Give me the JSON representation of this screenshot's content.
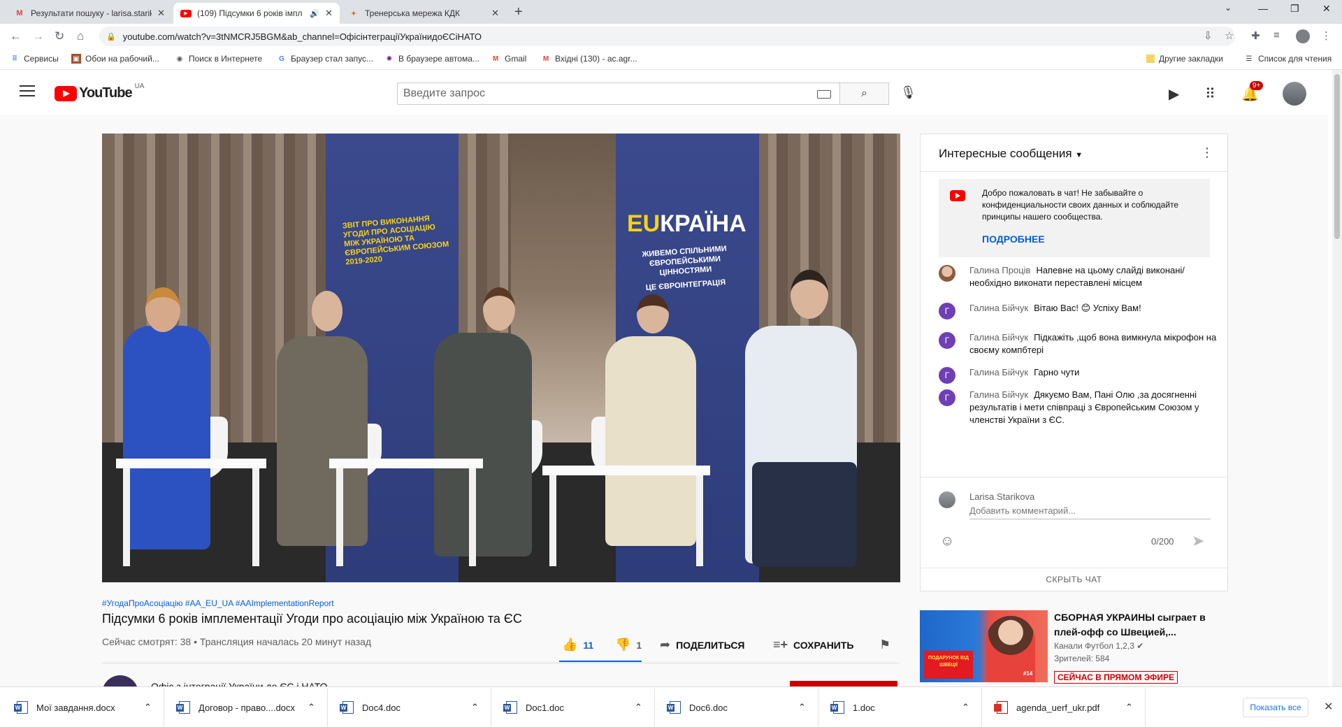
{
  "browser": {
    "tabs": [
      {
        "title": "Результати пошуку - larisa.stariko",
        "favicon": "gmail-icon"
      },
      {
        "title": "(109) Підсумки 6 років імпл",
        "favicon": "youtube-icon",
        "active": true
      },
      {
        "title": "Тренерська мережа КДК",
        "favicon": "site-icon"
      }
    ],
    "url": "youtube.com/watch?v=3tNMCRJ5BGM&ab_channel=ОфісінтеграціїУкраїнидоЄСіНАТО",
    "bookmarks": [
      {
        "label": "Сервисы",
        "icon": "apps-icon"
      },
      {
        "label": "Обои на рабочий...",
        "icon": "wallpaper-icon"
      },
      {
        "label": "Поиск в Интернете",
        "icon": "search-web-icon"
      },
      {
        "label": "Браузер стал запус...",
        "icon": "google-icon"
      },
      {
        "label": "В браузере автома...",
        "icon": "virus-icon"
      },
      {
        "label": "Gmail",
        "icon": "gmail-icon"
      },
      {
        "label": "Вхідні (130) - ac.agr...",
        "icon": "gmail-icon"
      }
    ],
    "other_bookmarks": "Другие закладки",
    "reading_list": "Список для чтения"
  },
  "youtube": {
    "country_code": "UA",
    "search_placeholder": "Введите запрос",
    "notification_count": "9+",
    "video": {
      "banner_left_text": "ЗВІТ ПРО ВИКОНАННЯ УГОДИ ПРО АСОЦІАЦІЮ МІЖ УКРАЇНОЮ ТА ЄВРОПЕЙСЬКИМ СОЮЗОМ 2019-2020",
      "banner_right_logo_eu": "EU",
      "banner_right_logo_rest": "КРАЇНА",
      "banner_right_slogan": "ЖИВЕМО СПІЛЬНИМИ ЄВРОПЕЙСЬКИМИ ЦІННОСТЯМИ",
      "banner_right_tag": "ЦЕ ЄВРОІНТЕГРАЦІЯ",
      "hashtags": "#УгодаПроАсоціацію #AA_EU_UA #AAImplementationReport",
      "title": "Підсумки 6 років імплементації Угоди про асоціацію між Україною та ЄС",
      "stats": "Сейчас смотрят: 38 • Трансляция началась 20 минут назад",
      "likes": "11",
      "dislikes": "1",
      "share_label": "ПОДЕЛИТЬСЯ",
      "save_label": "СОХРАНИТЬ",
      "channel_name": "Офіс з інтеграції України до ЄС і НАТО"
    },
    "chat": {
      "header": "Интересные сообщения",
      "welcome_text": "Добро пожаловать в чат! Не забывайте о конфиденциальности своих данных и соблюдайте принципы нашего сообщества.",
      "welcome_link": "ПОДРОБНЕЕ",
      "messages": [
        {
          "author": "Галина Проців",
          "text": "Напевне на цьому слайді виконані/ необхідно виконати переставлені місцем",
          "avatar": "photo"
        },
        {
          "author": "Галина Бійчук",
          "text": "Вітаю Вас! 😊 Успіху Вам!",
          "avatar": "Г"
        },
        {
          "author": "Галина Бійчук",
          "text": "Підкажіть ,щоб вона вимкнула мікрофон на своєму компбтері",
          "avatar": "Г"
        },
        {
          "author": "Галина Бійчук",
          "text": "Гарно чути",
          "avatar": "Г"
        },
        {
          "author": "Галина Бійчук",
          "text": "Дякуємо Вам, Пані Олю ,за досягненні результатів і мети співпраці з Європейським Союзом у членстві України з ЄС.",
          "avatar": "Г"
        }
      ],
      "current_user": "Larisa Starikova",
      "comment_placeholder": "Добавить комментарий...",
      "char_count": "0/200",
      "hide_chat": "СКРЫТЬ ЧАТ"
    },
    "recommended": {
      "title": "СБОРНАЯ УКРАИНЫ сыграет в плей-офф со Швецией,...",
      "channel": "Канали Футбол 1,2,3",
      "viewers": "Зрителей: 584",
      "live_badge": "СЕЙЧАС В ПРЯМОМ ЭФИРЕ",
      "thumb_promo": "ПОДАРУНОК ВІД ШВЕЦІЇ",
      "thumb_tag": "#14"
    }
  },
  "downloads": {
    "items": [
      {
        "name": "Мої завдання.docx",
        "type": "word"
      },
      {
        "name": "Договор - право....docx",
        "type": "word"
      },
      {
        "name": "Doc4.doc",
        "type": "word"
      },
      {
        "name": "Doc1.doc",
        "type": "word"
      },
      {
        "name": "Doc6.doc",
        "type": "word"
      },
      {
        "name": "1.doc",
        "type": "word"
      },
      {
        "name": "agenda_uerf_ukr.pdf",
        "type": "pdf"
      }
    ],
    "show_all": "Показать все"
  }
}
